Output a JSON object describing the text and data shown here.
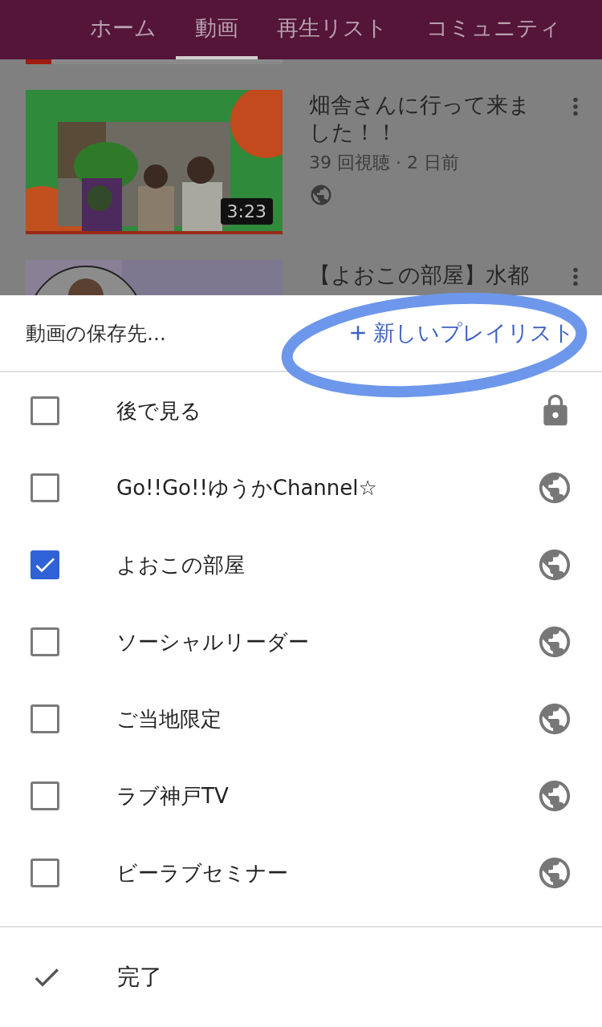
{
  "tabs": [
    {
      "label": "ホーム",
      "selected": false
    },
    {
      "label": "動画",
      "selected": true
    },
    {
      "label": "再生リスト",
      "selected": false
    },
    {
      "label": "コミュニティ",
      "selected": false
    }
  ],
  "previous_video_progress": {
    "level": 0.1
  },
  "videos": [
    {
      "kind": "full",
      "title": "畑舎さんに行って来ました！！",
      "meta": "39 回視聴 · 2 日前",
      "duration": "3:23"
    },
    {
      "kind": "partial",
      "title": "【よおこの部屋】水都"
    }
  ],
  "sheet": {
    "title": "動画の保存先...",
    "new_playlist": "新しいプレイリスト",
    "playlists": [
      {
        "name": "後で見る",
        "checked": false,
        "private": true
      },
      {
        "name": "Go!!Go!!ゆうかChannel☆",
        "checked": false,
        "private": false
      },
      {
        "name": "よおこの部屋",
        "checked": true,
        "private": false
      },
      {
        "name": "ソーシャルリーダー",
        "checked": false,
        "private": false
      },
      {
        "name": "ご当地限定",
        "checked": false,
        "private": false
      },
      {
        "name": "ラブ神戸TV",
        "checked": false,
        "private": false
      },
      {
        "name": "ビーラブセミナー",
        "checked": false,
        "private": false
      }
    ],
    "done": "完了"
  }
}
